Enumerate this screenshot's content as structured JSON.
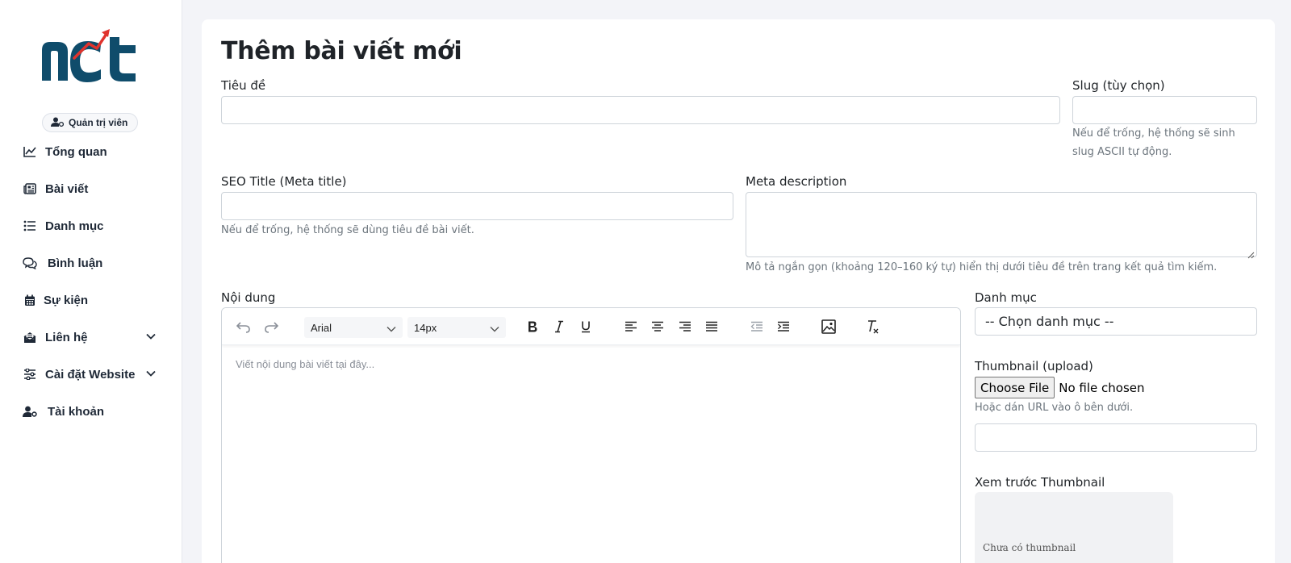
{
  "sidebar": {
    "brand_color": "#0f4c6b",
    "accent_color": "#e0332d",
    "role_badge": "Quản trị viên",
    "items": [
      {
        "label": "Tổng quan",
        "icon": "chart-line-icon"
      },
      {
        "label": "Bài viết",
        "icon": "newspaper-icon"
      },
      {
        "label": "Danh mục",
        "icon": "list-icon"
      },
      {
        "label": "Bình luận",
        "icon": "comments-icon"
      },
      {
        "label": "Sự kiện",
        "icon": "calendar-icon"
      },
      {
        "label": "Liên hệ",
        "icon": "envelope-open-icon",
        "has_dropdown": true
      },
      {
        "label": "Cài đặt Website",
        "icon": "sliders-icon",
        "has_dropdown": true
      },
      {
        "label": "Tài khoản",
        "icon": "user-gear-icon"
      }
    ]
  },
  "page": {
    "title": "Thêm bài viết mới"
  },
  "form": {
    "title_label": "Tiêu đề",
    "title_value": "",
    "slug_label": "Slug (tùy chọn)",
    "slug_value": "",
    "slug_help_line1": "Nếu để trống, hệ thống sẽ sinh",
    "slug_help_line2": "slug ASCII tự động.",
    "seo_title_label": "SEO Title (Meta title)",
    "seo_title_value": "",
    "seo_title_help": "Nếu để trống, hệ thống sẽ dùng tiêu đề bài viết.",
    "meta_desc_label": "Meta description",
    "meta_desc_value": "",
    "meta_desc_help": "Mô tả ngắn gọn (khoảng 120–160 ký tự) hiển thị dưới tiêu đề trên trang kết quả tìm kiếm.",
    "content_label": "Nội dung",
    "category_label": "Danh mục",
    "category_selected": "-- Chọn danh mục --",
    "thumbnail_label": "Thumbnail (upload)",
    "file_button": "Choose File",
    "file_status": "No file chosen",
    "thumbnail_help": "Hoặc dán URL vào ô bên dưới.",
    "thumbnail_url_value": "",
    "preview_label": "Xem trước Thumbnail",
    "preview_empty": "Chưa có thumbnail"
  },
  "editor": {
    "font_family": "Arial",
    "font_size": "14px",
    "placeholder": "Viết nội dung bài viết tại đây..."
  }
}
